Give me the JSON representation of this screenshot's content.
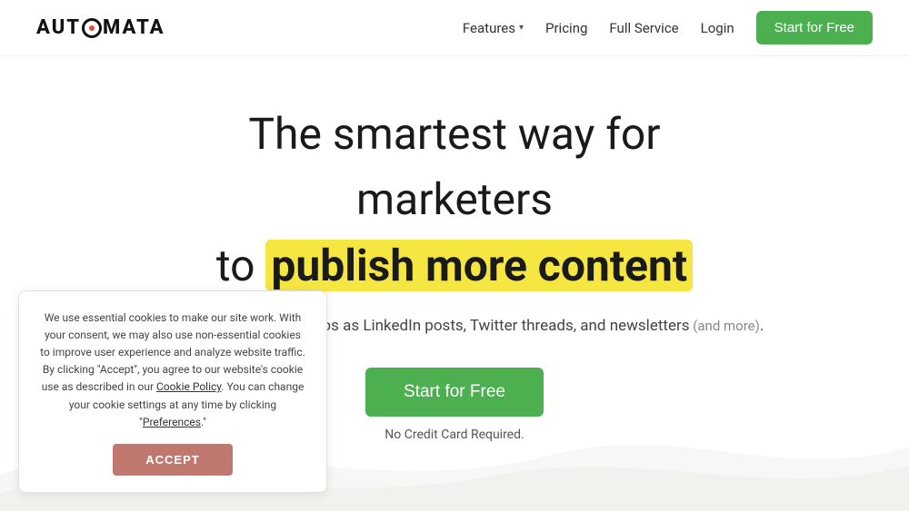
{
  "header": {
    "logo_text_before": "AUT",
    "logo_text_after": "MATA",
    "nav": {
      "features_label": "Features",
      "pricing_label": "Pricing",
      "full_service_label": "Full Service",
      "login_label": "Login",
      "start_free_label": "Start for Free"
    }
  },
  "hero": {
    "line1": "The smartest way for",
    "line2": "marketers",
    "line3_prefix": "to ",
    "line3_highlight": "publish more content",
    "subtitle_main": "Repurpose blogs and videos as LinkedIn posts, Twitter threads, and newsletters",
    "subtitle_more": " (and more)",
    "subtitle_end": ".",
    "cta_label": "Start for Free",
    "no_cc": "No Credit Card Required."
  },
  "cookie": {
    "text": "We use essential cookies to make our site work. With your consent, we may also use non-essential cookies to improve user experience and analyze website traffic. By clicking \"Accept\", you agree to our website's cookie use as described in our Cookie Policy. You can change your cookie settings at any time by clicking \"Preferences\".",
    "cookie_policy_link": "Cookie Policy",
    "preferences_link": "Preferences",
    "accept_label": "ACCEPT"
  },
  "colors": {
    "green": "#4caf50",
    "highlight_yellow": "#f5e642",
    "accept_red": "#c0786e"
  }
}
